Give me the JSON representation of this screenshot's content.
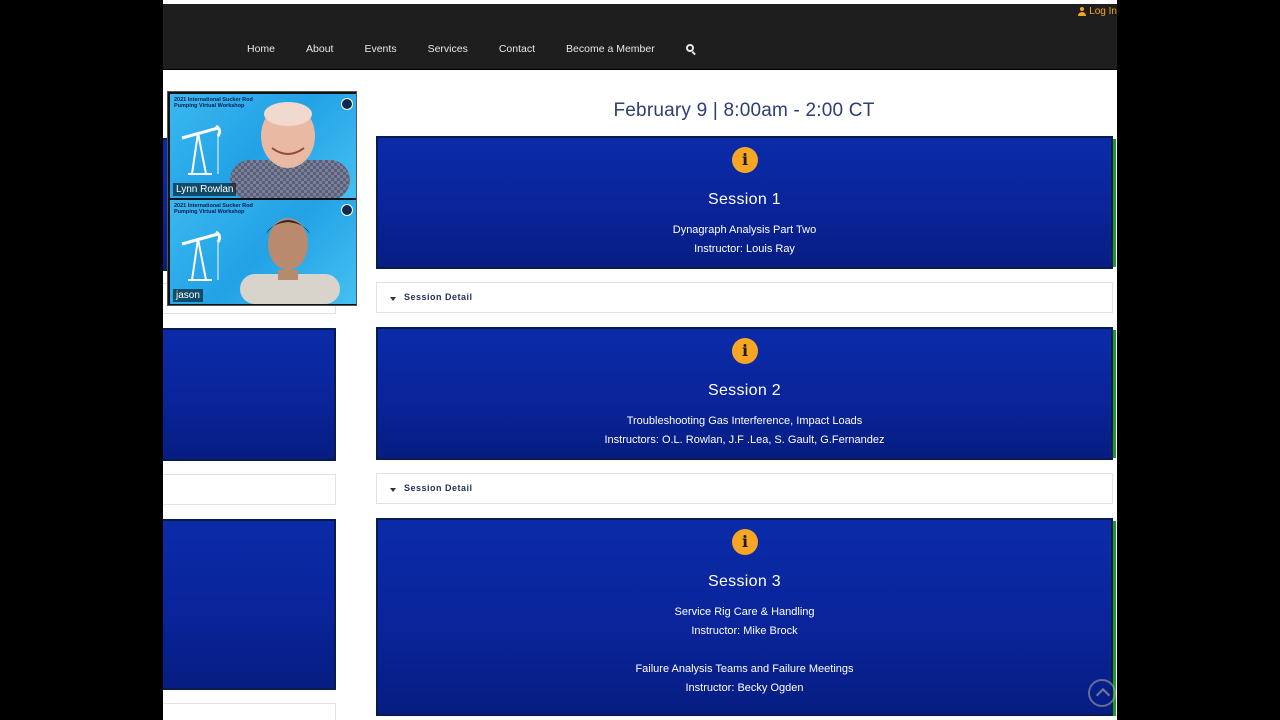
{
  "header": {
    "login_label": "Log In",
    "nav": [
      "Home",
      "About",
      "Events",
      "Services",
      "Contact",
      "Become a Member"
    ],
    "icons": {
      "login": "user-icon",
      "search": "search-icon"
    }
  },
  "schedule": {
    "date_heading": "February 9 | 8:00am - 2:00 CT",
    "detail_label": "Session Detail",
    "sessions": [
      {
        "title": "Session 1",
        "lines": [
          "Dynagraph Analysis Part Two",
          "Instructor: Louis Ray"
        ]
      },
      {
        "title": "Session 2",
        "lines": [
          "Troubleshooting Gas Interference, Impact Loads",
          "Instructors: O.L. Rowlan, J.F .Lea, S. Gault, G.Fernandez"
        ]
      },
      {
        "title": "Session 3",
        "lines": [
          "Service Rig Care & Handling",
          "Instructor: Mike Brock",
          "Failure Analysis Teams and Failure Meetings",
          "Instructor: Becky Ogden"
        ]
      }
    ]
  },
  "video_call": {
    "tile_title": "2021 International Sucker Rod Pumping Virtual Workshop",
    "participants": [
      {
        "name": "Lynn Rowlan"
      },
      {
        "name": "jason"
      }
    ]
  },
  "colors": {
    "nav_bg": "#1e1e1e",
    "session_bg": "#0a2ba8",
    "info_icon": "#f6a623",
    "heading": "#2c3e73",
    "accent_login": "#f5a623"
  }
}
